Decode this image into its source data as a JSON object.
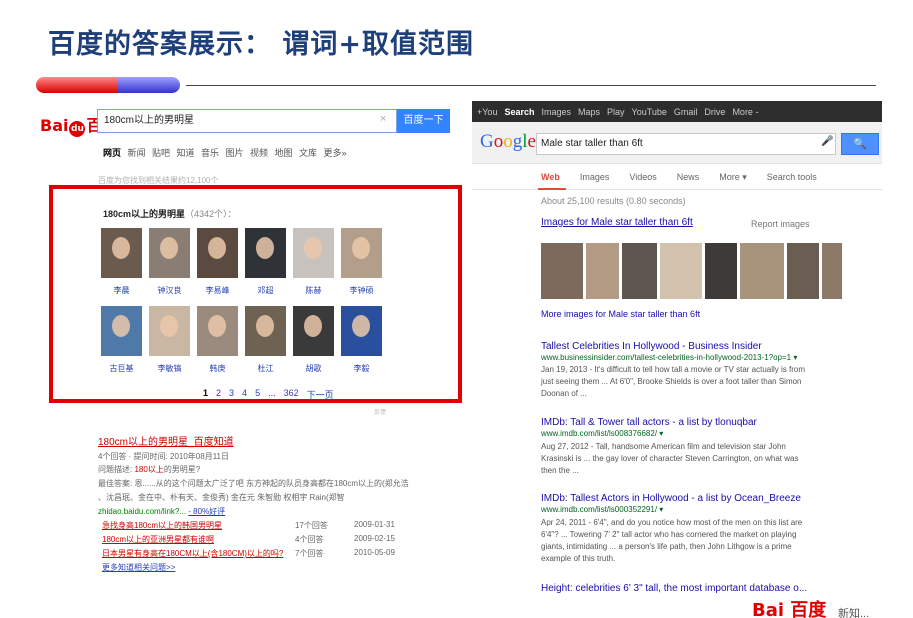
{
  "slide": {
    "title": "百度的答案展示： 谓词+取值范围"
  },
  "baidu": {
    "logo_left": "Bai",
    "logo_paw": "du",
    "logo_right": "百度",
    "query": "180cm以上的男明星",
    "search_button": "百度一下",
    "clear_icon": "×",
    "nav": [
      "网页",
      "新闻",
      "贴吧",
      "知道",
      "音乐",
      "图片",
      "视频",
      "地图",
      "文库",
      "更多»"
    ],
    "result_count": "百度为您找到相关结果约12,100个",
    "card": {
      "title": "180cm以上的男明星",
      "count": "（4342个）：",
      "faces": [
        {
          "name": "李晨",
          "bg": "#6b5a4e"
        },
        {
          "name": "钟汉良",
          "bg": "#8a7d74"
        },
        {
          "name": "李易峰",
          "bg": "#5a4a3f"
        },
        {
          "name": "邓超",
          "bg": "#2f3338"
        },
        {
          "name": "陈赫",
          "bg": "#c7c2bd"
        },
        {
          "name": "李钟硕",
          "bg": "#b39e8c"
        },
        {
          "name": "古巨基",
          "bg": "#4f79a8"
        },
        {
          "name": "李敏镐",
          "bg": "#c9b7a4"
        },
        {
          "name": "韩庚",
          "bg": "#9a8b7e"
        },
        {
          "name": "杜江",
          "bg": "#6e6253"
        },
        {
          "name": "胡歌",
          "bg": "#3a3a3a"
        },
        {
          "name": "李毅",
          "bg": "#2a4f9e"
        }
      ],
      "pages": [
        "1",
        "2",
        "3",
        "4",
        "5",
        "...",
        "362",
        "下一页"
      ],
      "feedback": "反馈"
    },
    "result": {
      "title": "180cm以上的男明星_百度知道",
      "meta": "4个回答 · 提问时间: 2010年08月11日",
      "question_prefix": "问题描述: ",
      "question_hl": "180",
      "question_mid": "以上",
      "question_suffix": "的男明星?",
      "answer": "最佳答案: 恩......从的这个问题太广泛了吧 东方神起的队员身高都在180cm以上的(郑允浩",
      "answer2": "、沈昌珉、金在中、朴有天、金俊秀) 金在元 朱智勋 权相宇 Rain(郑智",
      "url": "zhidao.baidu.com/link?... ",
      "url_link": "- 80%好评",
      "subs": [
        {
          "title": "急找身高180cm以上的韩国男明星",
          "count": "17个回答",
          "date": "2009-01-31"
        },
        {
          "title": "180cm以上的亚洲男星都有谁啊",
          "count": "4个回答",
          "date": "2009-02-15"
        },
        {
          "title": "日本男星有身高在180CM以上(含180CM)以上的吗?",
          "count": "7个回答",
          "date": "2010-05-09"
        }
      ],
      "more": "更多知道相关问题>>"
    },
    "watermark": "Bai 百度",
    "watermark_text": "新知..."
  },
  "google": {
    "topbar": [
      "+You",
      "Search",
      "Images",
      "Maps",
      "Play",
      "YouTube",
      "Gmail",
      "Drive",
      "More -"
    ],
    "logo_letters": [
      {
        "ch": "G",
        "color": "#3369e8"
      },
      {
        "ch": "o",
        "color": "#d50f25"
      },
      {
        "ch": "o",
        "color": "#eeb211"
      },
      {
        "ch": "g",
        "color": "#3369e8"
      },
      {
        "ch": "l",
        "color": "#009925"
      },
      {
        "ch": "e",
        "color": "#d50f25"
      }
    ],
    "query": "Male star taller than 6ft",
    "mic_icon": "🎤",
    "search_icon": "🔍",
    "tabs": [
      "Web",
      "Images",
      "Videos",
      "News",
      "More ▾",
      "Search tools"
    ],
    "result_count": "About 25,100 results (0.80 seconds)",
    "images_title": "Images for Male star taller than 6ft",
    "report_images": "Report images",
    "images": [
      {
        "bg": "#7c6a5c",
        "w": 42
      },
      {
        "bg": "#b39a84",
        "w": 33
      },
      {
        "bg": "#5d5650",
        "w": 35
      },
      {
        "bg": "#d2c2ae",
        "w": 42
      },
      {
        "bg": "#3d3a38",
        "w": 32
      },
      {
        "bg": "#a8947c",
        "w": 44
      },
      {
        "bg": "#6a5d52",
        "w": 32
      },
      {
        "bg": "#8d7968",
        "w": 20
      }
    ],
    "more_images": "More images for Male star taller than 6ft",
    "results": [
      {
        "title": "Tallest Celebrities In Hollywood - Business Insider",
        "url": "www.businessinsider.com/tallest-celebrities-in-hollywood-2013-1?op=1 ▾",
        "snippet": "Jan 19, 2013 - It's difficult to tell how tall a movie or TV star actually is from just seeing them ... At 6'0\", Brooke Shields is over a foot taller than Simon Doonan of ..."
      },
      {
        "title": "IMDb: Tall & Tower tall actors - a list by tlonuqbar",
        "url": "www.imdb.com/list/ls008376682/ ▾",
        "snippet": "Aug 27, 2012 - Tall, handsome American film and television star John Krasinski is ... the gay lover of character Steven Carrington, on what was then the ..."
      },
      {
        "title": "IMDb: Tallest Actors in Hollywood - a list by Ocean_Breeze",
        "url": "www.imdb.com/list/ls000352291/ ▾",
        "snippet": "Apr 24, 2011 - 6'4\", and do you notice how most of the men on this list are 6'4\"? ... Towering 7' 2\" tall actor who has cornered the market on playing giants, intimidating ... a person's life path, then John Lithgow is a prime example of this truth."
      },
      {
        "title": "Height: celebrities 6' 3\" tall, the most important database o...",
        "url": "",
        "snippet": ""
      }
    ]
  }
}
